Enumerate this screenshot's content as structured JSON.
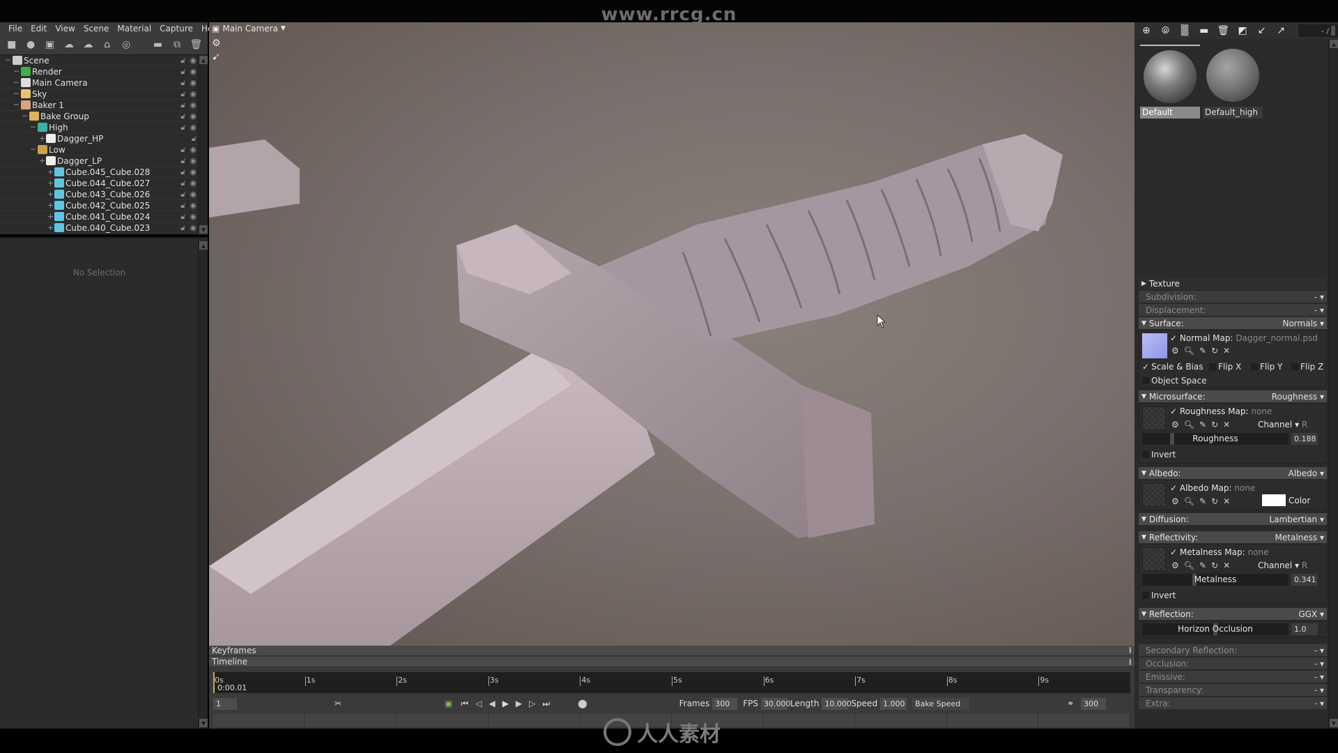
{
  "watermark_top": "www.rrcg.cn",
  "watermark_bottom": "人人素材",
  "menu": [
    "File",
    "Edit",
    "View",
    "Scene",
    "Material",
    "Capture",
    "Help"
  ],
  "scene_toolbar": [
    "add-mesh-icon",
    "add-light-icon",
    "add-camera-icon",
    "add-sky-icon",
    "add-environment-icon",
    "add-baker-icon",
    "add-audio-icon",
    "folder-icon",
    "duplicate-icon",
    "delete-icon"
  ],
  "outliner": {
    "items": [
      {
        "label": "Scene",
        "depth": 0,
        "icon": "scene-icon",
        "color": "#cccccc"
      },
      {
        "label": "Render",
        "depth": 1,
        "icon": "render-icon",
        "color": "#3fae4a"
      },
      {
        "label": "Main Camera",
        "depth": 1,
        "icon": "camera-icon",
        "color": "#dddddd"
      },
      {
        "label": "Sky",
        "depth": 1,
        "icon": "sky-icon",
        "color": "#e9c36a"
      },
      {
        "label": "Baker 1",
        "depth": 1,
        "icon": "baker-icon",
        "color": "#d9a57a"
      },
      {
        "label": "Bake Group",
        "depth": 2,
        "icon": "folder-icon",
        "color": "#e2b15c"
      },
      {
        "label": "High",
        "depth": 3,
        "icon": "high-group-icon",
        "color": "#3fb0a4"
      },
      {
        "label": "Dagger_HP",
        "depth": 4,
        "icon": "mesh-icon",
        "color": "#eeeeee"
      },
      {
        "label": "Low",
        "depth": 3,
        "icon": "low-group-icon",
        "color": "#c9a24a"
      },
      {
        "label": "Dagger_LP",
        "depth": 4,
        "icon": "mesh-icon",
        "color": "#eeeeee"
      },
      {
        "label": "Cube.045_Cube.028",
        "depth": 5,
        "icon": "cube-icon",
        "color": "#5ec6e4"
      },
      {
        "label": "Cube.044_Cube.027",
        "depth": 5,
        "icon": "cube-icon",
        "color": "#5ec6e4"
      },
      {
        "label": "Cube.043_Cube.026",
        "depth": 5,
        "icon": "cube-icon",
        "color": "#5ec6e4"
      },
      {
        "label": "Cube.042_Cube.025",
        "depth": 5,
        "icon": "cube-icon",
        "color": "#5ec6e4"
      },
      {
        "label": "Cube.041_Cube.024",
        "depth": 5,
        "icon": "cube-icon",
        "color": "#5ec6e4"
      },
      {
        "label": "Cube.040_Cube.023",
        "depth": 5,
        "icon": "cube-icon",
        "color": "#5ec6e4"
      }
    ]
  },
  "properties_empty": "No Selection",
  "viewport": {
    "camera": "Main Camera"
  },
  "timeline": {
    "keyframes_label": "Keyframes",
    "timeline_label": "Timeline",
    "ticks": [
      "0s",
      "1s",
      "2s",
      "3s",
      "4s",
      "5s",
      "6s",
      "7s",
      "8s",
      "9s"
    ],
    "current_time": "0:00.01",
    "current_frame": "1",
    "frames_label": "Frames",
    "frames": "300",
    "fps_label": "FPS",
    "fps": "30.000",
    "length_label": "Length",
    "length": "10.000",
    "speed_label": "Speed",
    "speed": "1.000",
    "bake_speed": "Bake Speed",
    "end_frame": "300"
  },
  "materials": {
    "counter": "- /",
    "items": [
      {
        "name": "Default",
        "selected": true
      },
      {
        "name": "Default_high",
        "selected": false
      }
    ]
  },
  "material_props": {
    "texture": "Texture",
    "subdivision": {
      "label": "Subdivision:",
      "value": "-"
    },
    "displacement": {
      "label": "Displacement:",
      "value": "-"
    },
    "surface": {
      "label": "Surface:",
      "value": "Normals",
      "map_label": "Normal Map:",
      "map_value": "Dagger_normal.psd",
      "scale_bias": "Scale & Bias",
      "flip_x": "Flip X",
      "flip_y": "Flip Y",
      "flip_z": "Flip Z",
      "object_space": "Object Space"
    },
    "microsurface": {
      "label": "Microsurface:",
      "value": "Roughness",
      "map_label": "Roughness Map:",
      "map_value": "none",
      "channel": "Channel",
      "channel_value": "R",
      "slider_label": "Roughness",
      "slider_value": "0.188",
      "invert": "Invert"
    },
    "albedo": {
      "label": "Albedo:",
      "value": "Albedo",
      "map_label": "Albedo Map:",
      "map_value": "none",
      "color_label": "Color",
      "color": "#ffffff"
    },
    "diffusion": {
      "label": "Diffusion:",
      "value": "Lambertian"
    },
    "reflectivity": {
      "label": "Reflectivity:",
      "value": "Metalness",
      "map_label": "Metalness Map:",
      "map_value": "none",
      "channel": "Channel",
      "channel_value": "R",
      "slider_label": "Metalness",
      "slider_value": "0.341",
      "invert": "Invert"
    },
    "reflection": {
      "label": "Reflection:",
      "value": "GGX",
      "slider_label": "Horizon Occlusion",
      "slider_value": "1.0"
    },
    "secondary_reflection": {
      "label": "Secondary Reflection:",
      "value": "-"
    },
    "occlusion": {
      "label": "Occlusion:",
      "value": "-"
    },
    "emissive": {
      "label": "Emissive:",
      "value": "-"
    },
    "transparency": {
      "label": "Transparency:",
      "value": "-"
    },
    "extra": {
      "label": "Extra:",
      "value": "-"
    }
  }
}
